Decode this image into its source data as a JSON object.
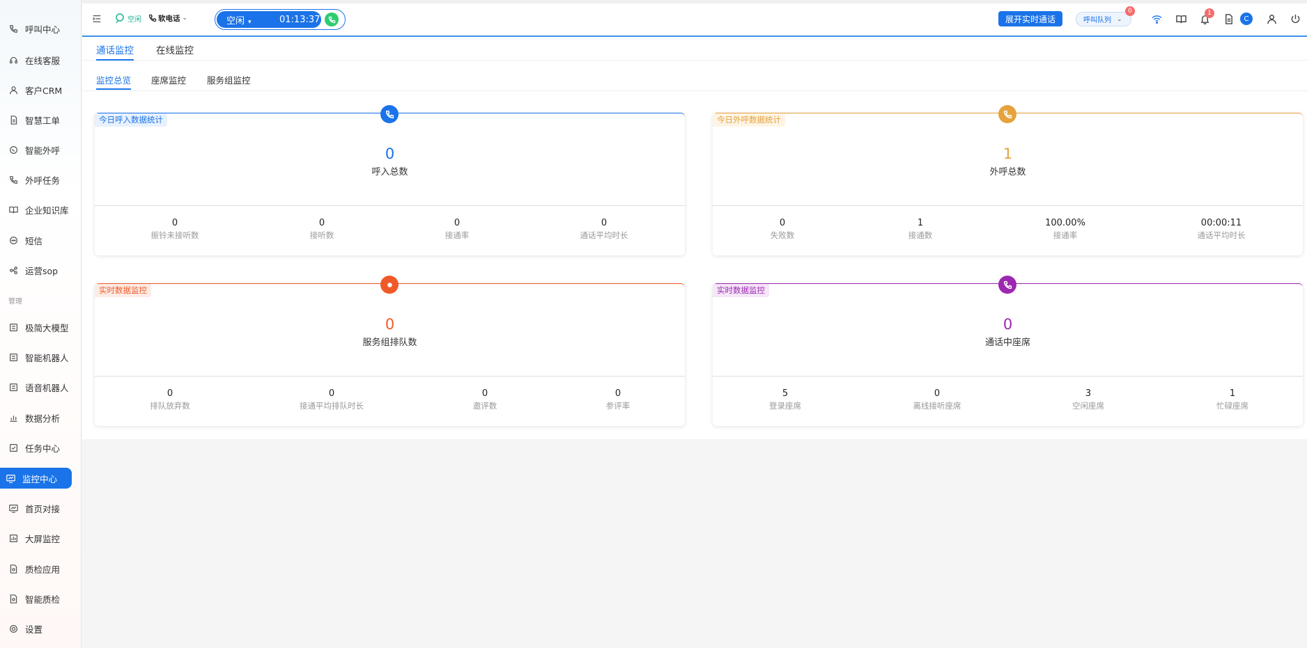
{
  "sidebar": {
    "section_manage": "管理",
    "items": [
      {
        "label": "呼叫中心",
        "icon": "phone-icon"
      },
      {
        "label": "在线客服",
        "icon": "headset-icon"
      },
      {
        "label": "客户CRM",
        "icon": "user-icon"
      },
      {
        "label": "智慧工单",
        "icon": "document-icon"
      },
      {
        "label": "智能外呼",
        "icon": "whatsapp-icon"
      },
      {
        "label": "外呼任务",
        "icon": "phone-task-icon"
      },
      {
        "label": "企业知识库",
        "icon": "book-icon"
      },
      {
        "label": "短信",
        "icon": "message-icon"
      },
      {
        "label": "运营sop",
        "icon": "flow-icon"
      },
      {
        "label": "极简大模型",
        "icon": "model-icon"
      },
      {
        "label": "智能机器人",
        "icon": "robot-icon"
      },
      {
        "label": "语音机器人",
        "icon": "voice-robot-icon"
      },
      {
        "label": "数据分析",
        "icon": "bar-chart-icon"
      },
      {
        "label": "任务中心",
        "icon": "checklist-icon"
      },
      {
        "label": "监控中心",
        "icon": "monitor-icon"
      },
      {
        "label": "首页对接",
        "icon": "monitor-line-icon"
      },
      {
        "label": "大屏监控",
        "icon": "dashboard-icon"
      },
      {
        "label": "质检应用",
        "icon": "inspect-icon"
      },
      {
        "label": "智能质检",
        "icon": "smart-inspect-icon"
      },
      {
        "label": "设置",
        "icon": "settings-icon"
      }
    ]
  },
  "header": {
    "status_label": "空闲",
    "phone_label": "软电话",
    "call_state": "空闲",
    "call_timer": "01:13:37",
    "expand_button": "展开实时通话",
    "queue_label": "呼叫队列",
    "queue_badge": "0",
    "notify_badge": "1",
    "avatar_letter": "C"
  },
  "tabs": {
    "level1": [
      "通话监控",
      "在线监控"
    ],
    "level2": [
      "监控总览",
      "座席监控",
      "服务组监控"
    ]
  },
  "colors": {
    "blue": "#1a73e8",
    "orange": "#e6a23c",
    "red": "#f05a28",
    "purple": "#9c27b0"
  },
  "cards": [
    {
      "tag": "今日呼入数据统计",
      "icon": "incoming-call-icon",
      "big_value": "0",
      "big_label": "呼入总数",
      "stats": [
        {
          "value": "0",
          "label": "振铃未接听数"
        },
        {
          "value": "0",
          "label": "接听数"
        },
        {
          "value": "0",
          "label": "接通率"
        },
        {
          "value": "0",
          "label": "通话平均时长"
        }
      ]
    },
    {
      "tag": "今日外呼数据统计",
      "icon": "outgoing-call-icon",
      "big_value": "1",
      "big_label": "外呼总数",
      "stats": [
        {
          "value": "0",
          "label": "失败数"
        },
        {
          "value": "1",
          "label": "接通数"
        },
        {
          "value": "100.00%",
          "label": "接通率"
        },
        {
          "value": "00:00:11",
          "label": "通话平均时长"
        }
      ]
    },
    {
      "tag": "实时数据监控",
      "icon": "record-icon",
      "big_value": "0",
      "big_label": "服务组排队数",
      "stats": [
        {
          "value": "0",
          "label": "排队放弃数"
        },
        {
          "value": "0",
          "label": "接通平均排队时长"
        },
        {
          "value": "0",
          "label": "邀评数"
        },
        {
          "value": "0",
          "label": "参评率"
        }
      ]
    },
    {
      "tag": "实时数据监控",
      "icon": "phone-talk-icon",
      "big_value": "0",
      "big_label": "通话中座席",
      "stats": [
        {
          "value": "5",
          "label": "登录座席"
        },
        {
          "value": "0",
          "label": "离线接听座席"
        },
        {
          "value": "3",
          "label": "空闲座席"
        },
        {
          "value": "1",
          "label": "忙碌座席"
        }
      ]
    }
  ]
}
